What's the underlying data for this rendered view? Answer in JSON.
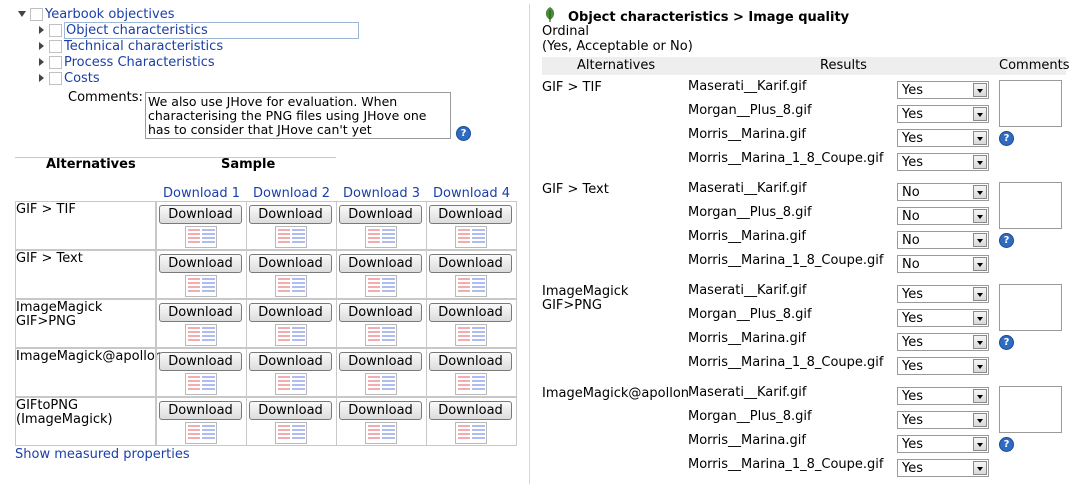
{
  "tree": {
    "root": "Yearbook objectives",
    "children": [
      "Object characteristics",
      "Technical characteristics",
      "Process Characteristics",
      "Costs"
    ]
  },
  "comments": {
    "label": "Comments:",
    "text": "We also use JHove for evaluation. When characterising the PNG files using JHove one has to consider that JHove can't yet"
  },
  "alternatives_table": {
    "header_alternatives": "Alternatives",
    "header_sample": "Sample",
    "download_headers": [
      "Download 1",
      "Download 2",
      "Download 3",
      "Download 4"
    ],
    "button_label": "Download",
    "rows": [
      {
        "label": "GIF > TIF"
      },
      {
        "label": "GIF > Text"
      },
      {
        "label": "ImageMagick GIF>PNG"
      },
      {
        "label": "ImageMagick@apollon"
      },
      {
        "label": "GIFtoPNG (ImageMagick)"
      }
    ],
    "show_measured": "Show measured properties"
  },
  "criterion": {
    "icon": "leaf-icon",
    "title": "Object characteristics > Image quality",
    "scale": "Ordinal",
    "values": "(Yes, Acceptable or No)",
    "headers": {
      "alternatives": "Alternatives",
      "results": "Results",
      "comments": "Comments"
    },
    "groups": [
      {
        "alternative": "GIF > TIF",
        "results": [
          {
            "file": "Maserati__Karif.gif",
            "value": "Yes"
          },
          {
            "file": "Morgan__Plus_8.gif",
            "value": "Yes"
          },
          {
            "file": "Morris__Marina.gif",
            "value": "Yes"
          },
          {
            "file": "Morris__Marina_1_8_Coupe.gif",
            "value": "Yes"
          }
        ]
      },
      {
        "alternative": "GIF > Text",
        "results": [
          {
            "file": "Maserati__Karif.gif",
            "value": "No"
          },
          {
            "file": "Morgan__Plus_8.gif",
            "value": "No"
          },
          {
            "file": "Morris__Marina.gif",
            "value": "No"
          },
          {
            "file": "Morris__Marina_1_8_Coupe.gif",
            "value": "No"
          }
        ]
      },
      {
        "alternative": "ImageMagick GIF>PNG",
        "results": [
          {
            "file": "Maserati__Karif.gif",
            "value": "Yes"
          },
          {
            "file": "Morgan__Plus_8.gif",
            "value": "Yes"
          },
          {
            "file": "Morris__Marina.gif",
            "value": "Yes"
          },
          {
            "file": "Morris__Marina_1_8_Coupe.gif",
            "value": "Yes"
          }
        ]
      },
      {
        "alternative": "ImageMagick@apollon",
        "results": [
          {
            "file": "Maserati__Karif.gif",
            "value": "Yes"
          },
          {
            "file": "Morgan__Plus_8.gif",
            "value": "Yes"
          },
          {
            "file": "Morris__Marina.gif",
            "value": "Yes"
          },
          {
            "file": "Morris__Marina_1_8_Coupe.gif",
            "value": "Yes"
          }
        ]
      }
    ]
  },
  "help_glyph": "?"
}
